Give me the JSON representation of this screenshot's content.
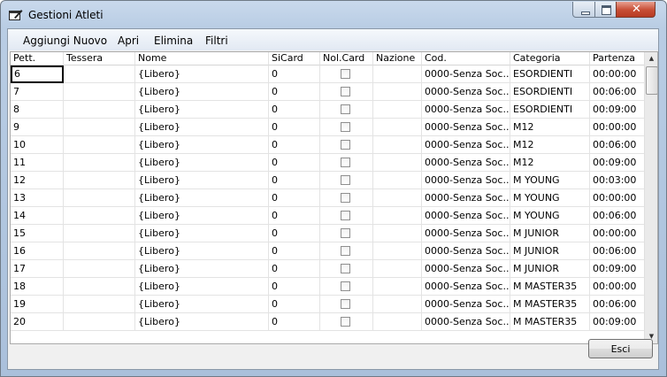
{
  "window": {
    "title": "Gestioni Atleti",
    "close_glyph": "✕"
  },
  "menu": [
    "Aggiungi Nuovo",
    "Apri",
    "Elimina",
    "Filtri"
  ],
  "columns": [
    "Pett.",
    "Tessera",
    "Nome",
    "SiCard",
    "Nol.Card",
    "Nazione",
    "Cod.",
    "Categoria",
    "Partenza"
  ],
  "rows": [
    {
      "pett": "6",
      "tessera": "",
      "nome": "{Libero}",
      "sicard": "0",
      "nolcard": false,
      "nazione": "",
      "cod": "0000-Senza  Soc...",
      "categoria": "ESORDIENTI",
      "partenza": "00:00:00"
    },
    {
      "pett": "7",
      "tessera": "",
      "nome": "{Libero}",
      "sicard": "0",
      "nolcard": false,
      "nazione": "",
      "cod": "0000-Senza  Soc...",
      "categoria": "ESORDIENTI",
      "partenza": "00:06:00"
    },
    {
      "pett": "8",
      "tessera": "",
      "nome": "{Libero}",
      "sicard": "0",
      "nolcard": false,
      "nazione": "",
      "cod": "0000-Senza  Soc...",
      "categoria": "ESORDIENTI",
      "partenza": "00:09:00"
    },
    {
      "pett": "9",
      "tessera": "",
      "nome": "{Libero}",
      "sicard": "0",
      "nolcard": false,
      "nazione": "",
      "cod": "0000-Senza  Soc...",
      "categoria": "M12",
      "partenza": "00:00:00"
    },
    {
      "pett": "10",
      "tessera": "",
      "nome": "{Libero}",
      "sicard": "0",
      "nolcard": false,
      "nazione": "",
      "cod": "0000-Senza  Soc...",
      "categoria": "M12",
      "partenza": "00:06:00"
    },
    {
      "pett": "11",
      "tessera": "",
      "nome": "{Libero}",
      "sicard": "0",
      "nolcard": false,
      "nazione": "",
      "cod": "0000-Senza  Soc...",
      "categoria": "M12",
      "partenza": "00:09:00"
    },
    {
      "pett": "12",
      "tessera": "",
      "nome": "{Libero}",
      "sicard": "0",
      "nolcard": false,
      "nazione": "",
      "cod": "0000-Senza  Soc...",
      "categoria": "M YOUNG",
      "partenza": "00:03:00"
    },
    {
      "pett": "13",
      "tessera": "",
      "nome": "{Libero}",
      "sicard": "0",
      "nolcard": false,
      "nazione": "",
      "cod": "0000-Senza  Soc...",
      "categoria": "M YOUNG",
      "partenza": "00:00:00"
    },
    {
      "pett": "14",
      "tessera": "",
      "nome": "{Libero}",
      "sicard": "0",
      "nolcard": false,
      "nazione": "",
      "cod": "0000-Senza  Soc...",
      "categoria": "M YOUNG",
      "partenza": "00:06:00"
    },
    {
      "pett": "15",
      "tessera": "",
      "nome": "{Libero}",
      "sicard": "0",
      "nolcard": false,
      "nazione": "",
      "cod": "0000-Senza  Soc...",
      "categoria": "M JUNIOR",
      "partenza": "00:00:00"
    },
    {
      "pett": "16",
      "tessera": "",
      "nome": "{Libero}",
      "sicard": "0",
      "nolcard": false,
      "nazione": "",
      "cod": "0000-Senza  Soc...",
      "categoria": "M JUNIOR",
      "partenza": "00:06:00"
    },
    {
      "pett": "17",
      "tessera": "",
      "nome": "{Libero}",
      "sicard": "0",
      "nolcard": false,
      "nazione": "",
      "cod": "0000-Senza  Soc...",
      "categoria": "M JUNIOR",
      "partenza": "00:09:00"
    },
    {
      "pett": "18",
      "tessera": "",
      "nome": "{Libero}",
      "sicard": "0",
      "nolcard": false,
      "nazione": "",
      "cod": "0000-Senza  Soc...",
      "categoria": "M MASTER35",
      "partenza": "00:00:00"
    },
    {
      "pett": "19",
      "tessera": "",
      "nome": "{Libero}",
      "sicard": "0",
      "nolcard": false,
      "nazione": "",
      "cod": "0000-Senza  Soc...",
      "categoria": "M MASTER35",
      "partenza": "00:06:00"
    },
    {
      "pett": "20",
      "tessera": "",
      "nome": "{Libero}",
      "sicard": "0",
      "nolcard": false,
      "nazione": "",
      "cod": "0000-Senza  Soc...",
      "categoria": "M MASTER35",
      "partenza": "00:09:00"
    }
  ],
  "footer": {
    "esci_label": "Esci"
  },
  "icons": {
    "app": "edit-window-icon",
    "scroll_up": "scroll-up-arrow-icon",
    "scroll_down": "scroll-down-arrow-icon"
  },
  "colors": {
    "title_bar": "#b9cde4",
    "close_button": "#c74d34",
    "grid_line": "#e3e3e3"
  }
}
